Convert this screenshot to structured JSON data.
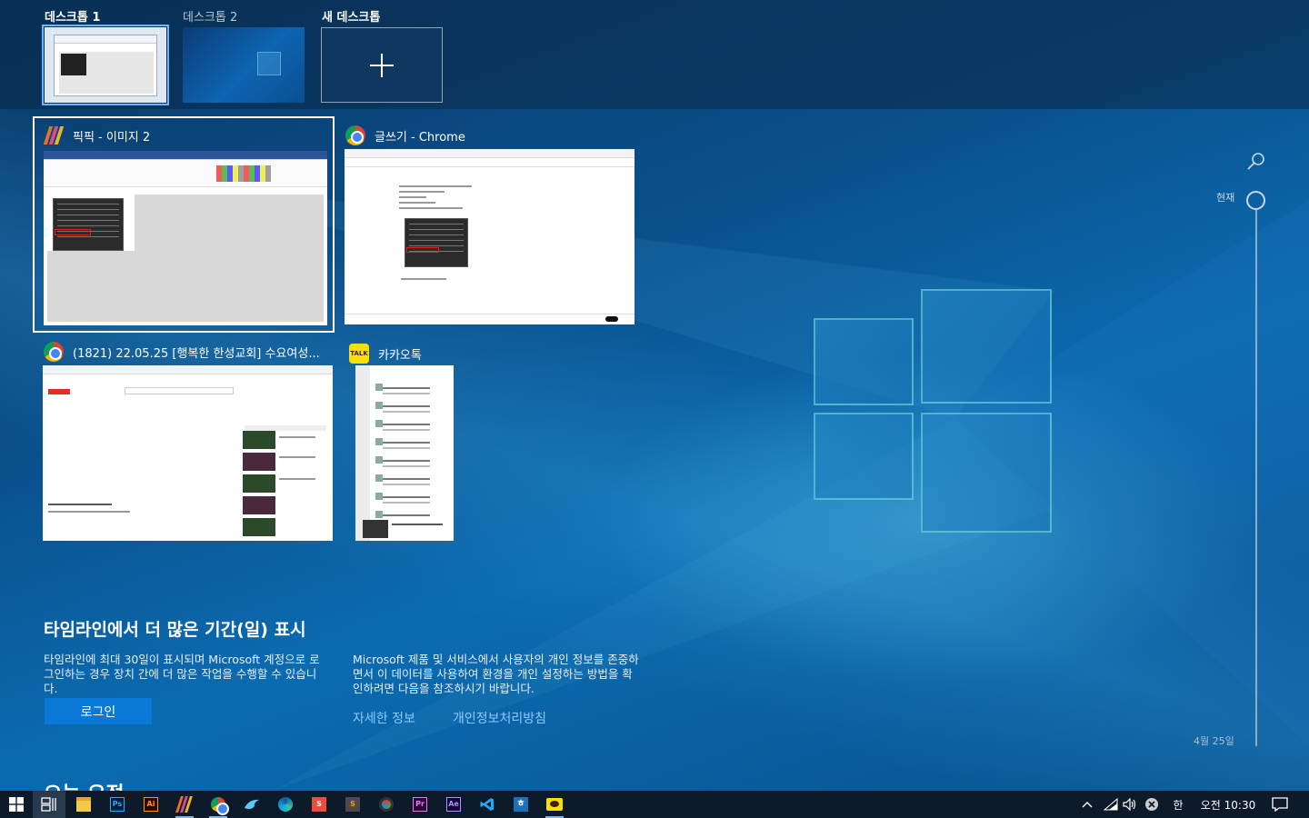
{
  "desktops": [
    {
      "label": "데스크톱 1",
      "active": true
    },
    {
      "label": "데스크톱 2",
      "active": false
    },
    {
      "label": "새 데스크톱",
      "active": false
    }
  ],
  "windows": [
    {
      "title": "픽픽 - 이미지 2",
      "icon": "picpick-icon",
      "selected": true
    },
    {
      "title": "글쓰기 - Chrome",
      "icon": "chrome-icon",
      "selected": false
    },
    {
      "title": "(1821) 22.05.25 [행복한 한성교회] 수요여성...",
      "icon": "chrome-icon",
      "selected": false
    },
    {
      "title": "카카오톡",
      "icon": "kakaotalk-icon",
      "selected": false
    }
  ],
  "kakao_icon_text": "TALK",
  "info": {
    "title": "타임라인에서 더 많은 기간(일) 표시",
    "left_text": "타임라인에 최대 30일이 표시되며 Microsoft 계정으로 로그인하는 경우 장치 간에 더 많은 작업을 수행할 수 있습니다.",
    "login_label": "로그인",
    "right_text": "Microsoft 제품 및 서비스에서 사용자의 개인 정보를 존중하면서 이 데이터를 사용하여 환경을 개인 설정하는 방법을 확인하려면 다음을 참조하시기 바랍니다.",
    "link_more": "자세한 정보",
    "link_privacy": "개인정보처리방침"
  },
  "today_heading": "오늘 요점",
  "timeline": {
    "now_label": "현재",
    "date_label": "4월 25일"
  },
  "taskbar": {
    "apps": [
      {
        "name": "start-button",
        "label": ""
      },
      {
        "name": "task-view-button",
        "label": ""
      },
      {
        "name": "file-explorer-icon",
        "label": ""
      },
      {
        "name": "photoshop-icon",
        "label": "Ps"
      },
      {
        "name": "illustrator-icon",
        "label": "Ai"
      },
      {
        "name": "picpick-icon",
        "label": ""
      },
      {
        "name": "chrome-icon",
        "label": ""
      },
      {
        "name": "bird-app-icon",
        "label": ""
      },
      {
        "name": "edge-icon",
        "label": ""
      },
      {
        "name": "s-app-icon",
        "label": "S"
      },
      {
        "name": "sublime-icon",
        "label": "S"
      },
      {
        "name": "davinci-icon",
        "label": ""
      },
      {
        "name": "premiere-icon",
        "label": "Pr"
      },
      {
        "name": "after-effects-icon",
        "label": "Ae"
      },
      {
        "name": "vscode-icon",
        "label": ""
      },
      {
        "name": "hangul-icon",
        "label": "ㅎ"
      },
      {
        "name": "kakaotalk-taskbar-icon",
        "label": ""
      }
    ],
    "ime_label": "한",
    "clock": "오전 10:30"
  },
  "colors": {
    "accent": "#0a78d7",
    "link": "#8fc8ff",
    "taskbar": "#0d1a2a"
  }
}
